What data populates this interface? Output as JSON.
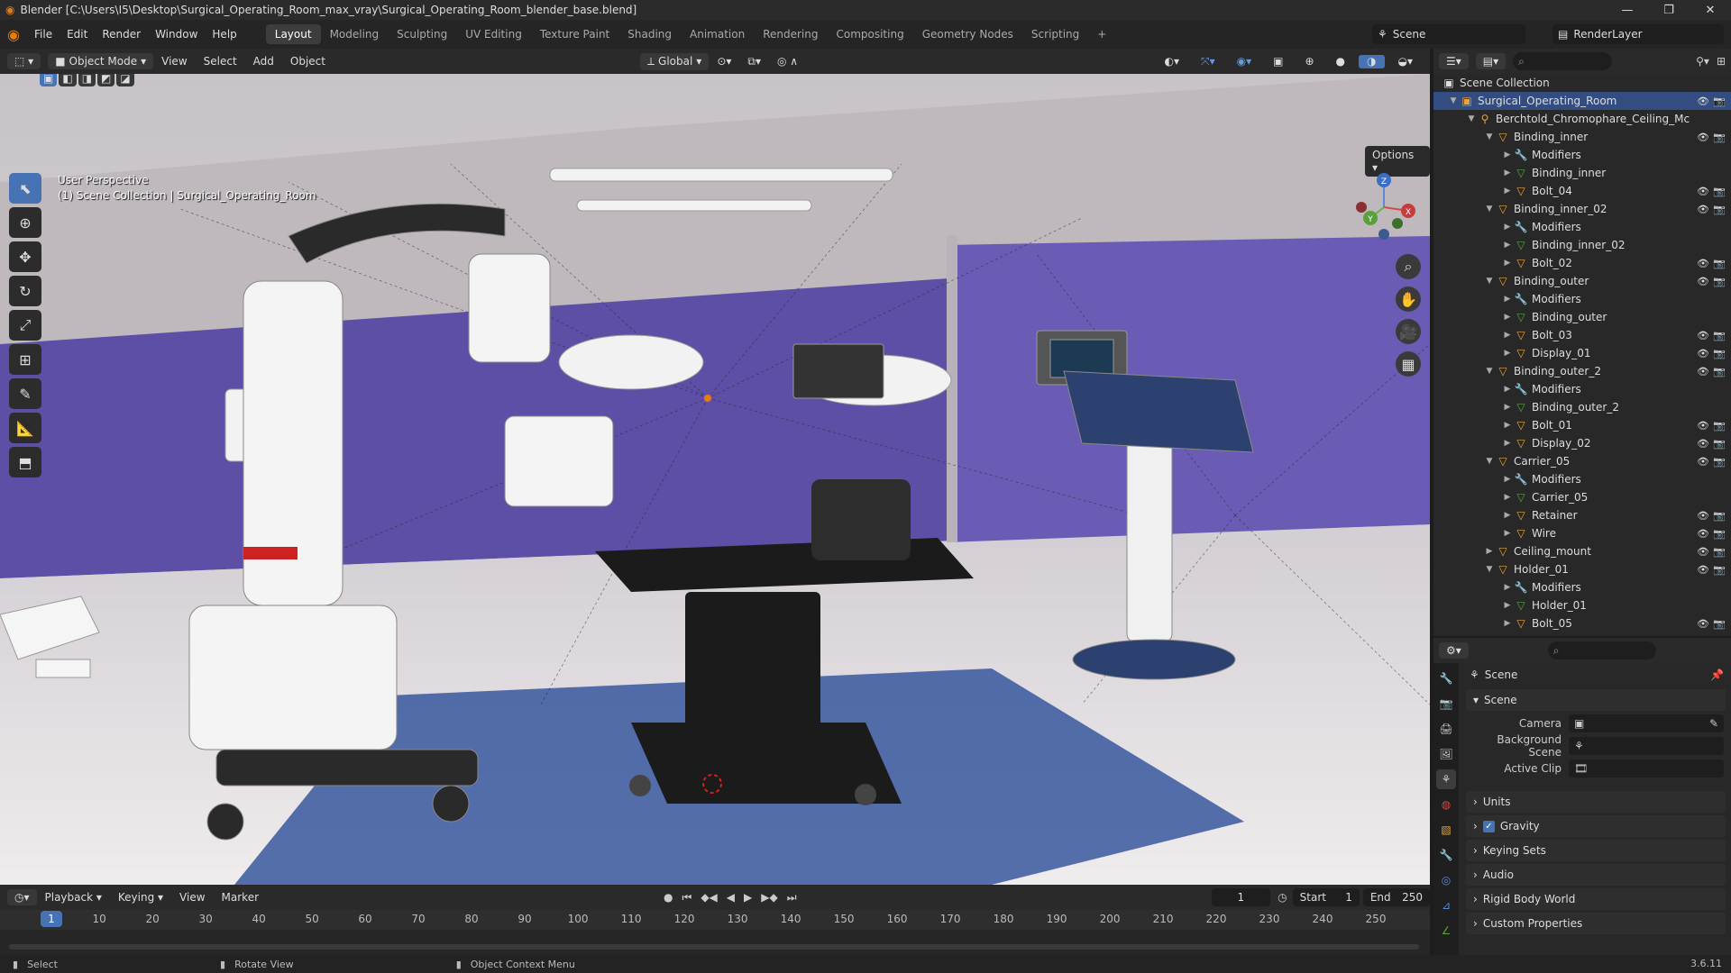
{
  "window": {
    "title": "Blender [C:\\Users\\I5\\Desktop\\Surgical_Operating_Room_max_vray\\Surgical_Operating_Room_blender_base.blend]",
    "controls": [
      "—",
      "❐",
      "✕"
    ]
  },
  "menu": {
    "items": [
      "File",
      "Edit",
      "Render",
      "Window",
      "Help"
    ],
    "workspaces": [
      "Layout",
      "Modeling",
      "Sculpting",
      "UV Editing",
      "Texture Paint",
      "Shading",
      "Animation",
      "Rendering",
      "Compositing",
      "Geometry Nodes",
      "Scripting",
      "+"
    ],
    "active_workspace": "Layout",
    "scene": "Scene",
    "view_layer": "RenderLayer"
  },
  "viewport_header": {
    "mode": "Object Mode",
    "menus": [
      "View",
      "Select",
      "Add",
      "Object"
    ],
    "transform_orientation": "Global",
    "options_label": "Options"
  },
  "viewport": {
    "perspective_label": "User Perspective",
    "collection_label": "(1) Scene Collection | Surgical_Operating_Room",
    "accent": "#4772b3",
    "gizmo_axes": [
      "Z",
      "Y",
      "X"
    ]
  },
  "outliner": {
    "root": "Scene Collection",
    "rows": [
      {
        "name": "Surgical_Operating_Room",
        "depth": 1,
        "icon": "collection-icon",
        "expanded": true,
        "selected": true,
        "vis": true
      },
      {
        "name": "Berchtold_Chromophare_Ceiling_Mc",
        "depth": 2,
        "icon": "armature-icon",
        "expanded": true,
        "vis": false
      },
      {
        "name": "Binding_inner",
        "depth": 3,
        "icon": "mesh-object-icon",
        "expanded": true,
        "vis": true
      },
      {
        "name": "Modifiers",
        "depth": 4,
        "icon": "wrench-icon",
        "expanded": false,
        "vis": false
      },
      {
        "name": "Binding_inner",
        "depth": 4,
        "icon": "mesh-data-icon",
        "expanded": false,
        "vis": false
      },
      {
        "name": "Bolt_04",
        "depth": 4,
        "icon": "mesh-object-icon",
        "expanded": false,
        "vis": true
      },
      {
        "name": "Binding_inner_02",
        "depth": 3,
        "icon": "mesh-object-icon",
        "expanded": true,
        "vis": true
      },
      {
        "name": "Modifiers",
        "depth": 4,
        "icon": "wrench-icon",
        "expanded": false,
        "vis": false
      },
      {
        "name": "Binding_inner_02",
        "depth": 4,
        "icon": "mesh-data-icon",
        "expanded": false,
        "vis": false
      },
      {
        "name": "Bolt_02",
        "depth": 4,
        "icon": "mesh-object-icon",
        "expanded": false,
        "vis": true
      },
      {
        "name": "Binding_outer",
        "depth": 3,
        "icon": "mesh-object-icon",
        "expanded": true,
        "vis": true
      },
      {
        "name": "Modifiers",
        "depth": 4,
        "icon": "wrench-icon",
        "expanded": false,
        "vis": false
      },
      {
        "name": "Binding_outer",
        "depth": 4,
        "icon": "mesh-data-icon",
        "expanded": false,
        "vis": false
      },
      {
        "name": "Bolt_03",
        "depth": 4,
        "icon": "mesh-object-icon",
        "expanded": false,
        "vis": true
      },
      {
        "name": "Display_01",
        "depth": 4,
        "icon": "mesh-object-icon",
        "expanded": false,
        "vis": true
      },
      {
        "name": "Binding_outer_2",
        "depth": 3,
        "icon": "mesh-object-icon",
        "expanded": true,
        "vis": true
      },
      {
        "name": "Modifiers",
        "depth": 4,
        "icon": "wrench-icon",
        "expanded": false,
        "vis": false
      },
      {
        "name": "Binding_outer_2",
        "depth": 4,
        "icon": "mesh-data-icon",
        "expanded": false,
        "vis": false
      },
      {
        "name": "Bolt_01",
        "depth": 4,
        "icon": "mesh-object-icon",
        "expanded": false,
        "vis": true
      },
      {
        "name": "Display_02",
        "depth": 4,
        "icon": "mesh-object-icon",
        "expanded": false,
        "vis": true
      },
      {
        "name": "Carrier_05",
        "depth": 3,
        "icon": "mesh-object-icon",
        "expanded": true,
        "vis": true
      },
      {
        "name": "Modifiers",
        "depth": 4,
        "icon": "wrench-icon",
        "expanded": false,
        "vis": false
      },
      {
        "name": "Carrier_05",
        "depth": 4,
        "icon": "mesh-data-icon",
        "expanded": false,
        "vis": false
      },
      {
        "name": "Retainer",
        "depth": 4,
        "icon": "mesh-object-icon",
        "expanded": false,
        "vis": true
      },
      {
        "name": "Wire",
        "depth": 4,
        "icon": "mesh-object-icon",
        "expanded": false,
        "vis": true
      },
      {
        "name": "Ceiling_mount",
        "depth": 3,
        "icon": "mesh-object-icon",
        "expanded": false,
        "vis": true
      },
      {
        "name": "Holder_01",
        "depth": 3,
        "icon": "mesh-object-icon",
        "expanded": true,
        "vis": true
      },
      {
        "name": "Modifiers",
        "depth": 4,
        "icon": "wrench-icon",
        "expanded": false,
        "vis": false
      },
      {
        "name": "Holder_01",
        "depth": 4,
        "icon": "mesh-data-icon",
        "expanded": false,
        "vis": false
      },
      {
        "name": "Bolt_05",
        "depth": 4,
        "icon": "mesh-object-icon",
        "expanded": false,
        "vis": true
      }
    ]
  },
  "properties": {
    "context": "Scene",
    "panel_title": "Scene",
    "fields": {
      "camera_label": "Camera",
      "background_scene_label": "Background Scene",
      "active_clip_label": "Active Clip"
    },
    "sections": [
      "Units",
      "Gravity",
      "Keying Sets",
      "Audio",
      "Rigid Body World",
      "Custom Properties"
    ],
    "gravity_checked": true
  },
  "timeline": {
    "menus": [
      "Playback",
      "Keying",
      "View",
      "Marker"
    ],
    "current_frame": "1",
    "start_label": "Start",
    "start": "1",
    "end_label": "End",
    "end": "250",
    "ticks": [
      1,
      10,
      20,
      30,
      40,
      50,
      60,
      70,
      80,
      90,
      100,
      110,
      120,
      130,
      140,
      150,
      160,
      170,
      180,
      190,
      200,
      210,
      220,
      230,
      240,
      250
    ]
  },
  "statusbar": {
    "select": "Select",
    "rotate": "Rotate View",
    "context_menu": "Object Context Menu",
    "version": "3.6.11"
  }
}
